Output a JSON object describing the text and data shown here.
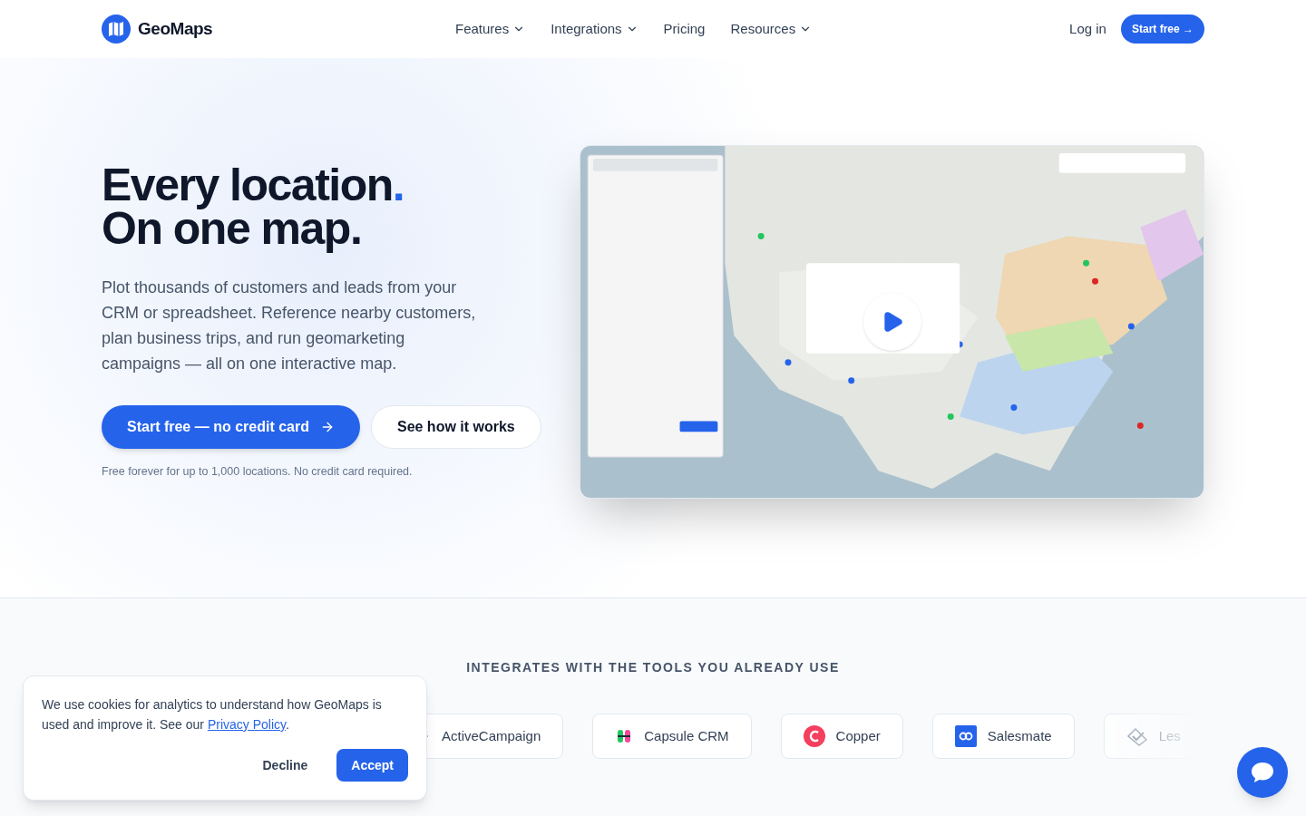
{
  "header": {
    "brand": "GeoMaps",
    "nav": [
      {
        "label": "Features",
        "dropdown": true
      },
      {
        "label": "Integrations",
        "dropdown": true
      },
      {
        "label": "Pricing",
        "dropdown": false
      },
      {
        "label": "Resources",
        "dropdown": true
      }
    ],
    "login": "Log in",
    "cta": "Start free →"
  },
  "hero": {
    "title_line1": "Every location",
    "title_dot": ".",
    "title_line2": "On one map.",
    "description": "Plot thousands of customers and leads from your CRM or spreadsheet. Reference nearby customers, plan business trips, and run geomarketing campaigns — all on one interactive map.",
    "primary_button": "Start free — no credit card",
    "secondary_button": "See how it works",
    "note": "Free forever for up to 1,000 locations. No credit card required."
  },
  "integrations": {
    "heading": "INTEGRATES WITH THE TOOLS YOU ALREADY USE",
    "items": [
      {
        "name": "ActiveCampaign",
        "kind": "chevron"
      },
      {
        "name": "Capsule CRM",
        "kind": "capsule"
      },
      {
        "name": "Copper",
        "kind": "copper"
      },
      {
        "name": "Salesmate",
        "kind": "salesmate"
      },
      {
        "name": "Les",
        "kind": "check"
      }
    ]
  },
  "cookie_banner": {
    "text": "We use cookies for analytics to understand how GeoMaps is used and improve it. See our",
    "link": "Privacy Policy",
    "after": ".",
    "decline": "Decline",
    "accept": "Accept"
  }
}
